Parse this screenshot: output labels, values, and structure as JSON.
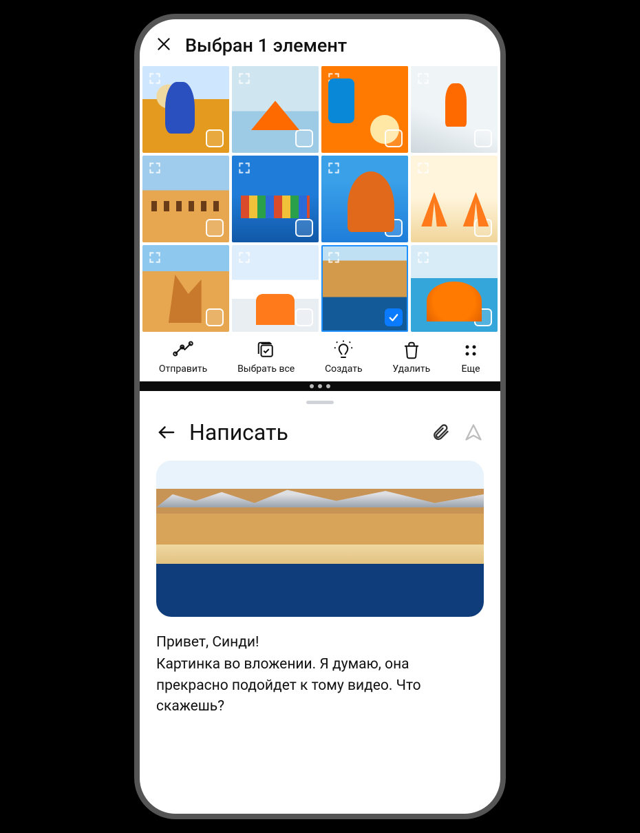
{
  "gallery": {
    "title": "Выбран 1 элемент",
    "tiles": [
      {
        "name": "photo-woman-field",
        "selected": false
      },
      {
        "name": "photo-paper-boat",
        "selected": false
      },
      {
        "name": "photo-flatlay",
        "selected": false
      },
      {
        "name": "photo-skier",
        "selected": false
      },
      {
        "name": "photo-camels",
        "selected": false
      },
      {
        "name": "photo-houses",
        "selected": false
      },
      {
        "name": "photo-arch",
        "selected": false
      },
      {
        "name": "photo-deckchairs",
        "selected": false
      },
      {
        "name": "photo-rocks",
        "selected": false
      },
      {
        "name": "photo-snow-chairs",
        "selected": false
      },
      {
        "name": "photo-coast",
        "selected": true
      },
      {
        "name": "photo-umbrella",
        "selected": false
      }
    ],
    "toolbar": {
      "send": "Отправить",
      "select": "Выбрать все",
      "create": "Создать",
      "delete": "Удалить",
      "more": "Еще"
    }
  },
  "compose": {
    "title": "Написать",
    "greeting": "Привет, Синди!",
    "body": "Картинка во вложении. Я думаю, она прекрасно подойдет к тому видео. Что скажешь?"
  }
}
